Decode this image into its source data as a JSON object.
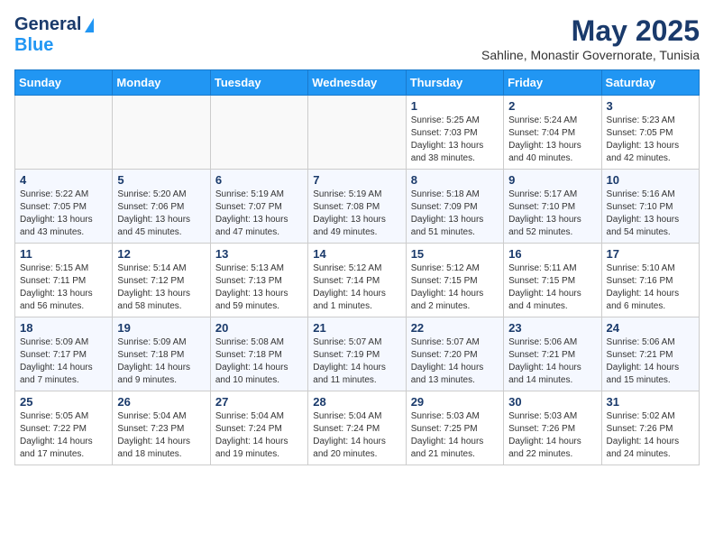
{
  "header": {
    "logo": {
      "general": "General",
      "blue": "Blue"
    },
    "title": "May 2025",
    "subtitle": "Sahline, Monastir Governorate, Tunisia"
  },
  "weekdays": [
    "Sunday",
    "Monday",
    "Tuesday",
    "Wednesday",
    "Thursday",
    "Friday",
    "Saturday"
  ],
  "weeks": [
    [
      null,
      null,
      null,
      null,
      {
        "day": 1,
        "sunrise": "5:25 AM",
        "sunset": "7:03 PM",
        "daylight_hours": 13,
        "daylight_minutes": 38
      },
      {
        "day": 2,
        "sunrise": "5:24 AM",
        "sunset": "7:04 PM",
        "daylight_hours": 13,
        "daylight_minutes": 40
      },
      {
        "day": 3,
        "sunrise": "5:23 AM",
        "sunset": "7:05 PM",
        "daylight_hours": 13,
        "daylight_minutes": 42
      }
    ],
    [
      {
        "day": 4,
        "sunrise": "5:22 AM",
        "sunset": "7:05 PM",
        "daylight_hours": 13,
        "daylight_minutes": 43
      },
      {
        "day": 5,
        "sunrise": "5:20 AM",
        "sunset": "7:06 PM",
        "daylight_hours": 13,
        "daylight_minutes": 45
      },
      {
        "day": 6,
        "sunrise": "5:19 AM",
        "sunset": "7:07 PM",
        "daylight_hours": 13,
        "daylight_minutes": 47
      },
      {
        "day": 7,
        "sunrise": "5:19 AM",
        "sunset": "7:08 PM",
        "daylight_hours": 13,
        "daylight_minutes": 49
      },
      {
        "day": 8,
        "sunrise": "5:18 AM",
        "sunset": "7:09 PM",
        "daylight_hours": 13,
        "daylight_minutes": 51
      },
      {
        "day": 9,
        "sunrise": "5:17 AM",
        "sunset": "7:10 PM",
        "daylight_hours": 13,
        "daylight_minutes": 52
      },
      {
        "day": 10,
        "sunrise": "5:16 AM",
        "sunset": "7:10 PM",
        "daylight_hours": 13,
        "daylight_minutes": 54
      }
    ],
    [
      {
        "day": 11,
        "sunrise": "5:15 AM",
        "sunset": "7:11 PM",
        "daylight_hours": 13,
        "daylight_minutes": 56
      },
      {
        "day": 12,
        "sunrise": "5:14 AM",
        "sunset": "7:12 PM",
        "daylight_hours": 13,
        "daylight_minutes": 58
      },
      {
        "day": 13,
        "sunrise": "5:13 AM",
        "sunset": "7:13 PM",
        "daylight_hours": 13,
        "daylight_minutes": 59
      },
      {
        "day": 14,
        "sunrise": "5:12 AM",
        "sunset": "7:14 PM",
        "daylight_hours": 14,
        "daylight_minutes": 1
      },
      {
        "day": 15,
        "sunrise": "5:12 AM",
        "sunset": "7:15 PM",
        "daylight_hours": 14,
        "daylight_minutes": 2
      },
      {
        "day": 16,
        "sunrise": "5:11 AM",
        "sunset": "7:15 PM",
        "daylight_hours": 14,
        "daylight_minutes": 4
      },
      {
        "day": 17,
        "sunrise": "5:10 AM",
        "sunset": "7:16 PM",
        "daylight_hours": 14,
        "daylight_minutes": 6
      }
    ],
    [
      {
        "day": 18,
        "sunrise": "5:09 AM",
        "sunset": "7:17 PM",
        "daylight_hours": 14,
        "daylight_minutes": 7
      },
      {
        "day": 19,
        "sunrise": "5:09 AM",
        "sunset": "7:18 PM",
        "daylight_hours": 14,
        "daylight_minutes": 9
      },
      {
        "day": 20,
        "sunrise": "5:08 AM",
        "sunset": "7:18 PM",
        "daylight_hours": 14,
        "daylight_minutes": 10
      },
      {
        "day": 21,
        "sunrise": "5:07 AM",
        "sunset": "7:19 PM",
        "daylight_hours": 14,
        "daylight_minutes": 11
      },
      {
        "day": 22,
        "sunrise": "5:07 AM",
        "sunset": "7:20 PM",
        "daylight_hours": 14,
        "daylight_minutes": 13
      },
      {
        "day": 23,
        "sunrise": "5:06 AM",
        "sunset": "7:21 PM",
        "daylight_hours": 14,
        "daylight_minutes": 14
      },
      {
        "day": 24,
        "sunrise": "5:06 AM",
        "sunset": "7:21 PM",
        "daylight_hours": 14,
        "daylight_minutes": 15
      }
    ],
    [
      {
        "day": 25,
        "sunrise": "5:05 AM",
        "sunset": "7:22 PM",
        "daylight_hours": 14,
        "daylight_minutes": 17
      },
      {
        "day": 26,
        "sunrise": "5:04 AM",
        "sunset": "7:23 PM",
        "daylight_hours": 14,
        "daylight_minutes": 18
      },
      {
        "day": 27,
        "sunrise": "5:04 AM",
        "sunset": "7:24 PM",
        "daylight_hours": 14,
        "daylight_minutes": 19
      },
      {
        "day": 28,
        "sunrise": "5:04 AM",
        "sunset": "7:24 PM",
        "daylight_hours": 14,
        "daylight_minutes": 20
      },
      {
        "day": 29,
        "sunrise": "5:03 AM",
        "sunset": "7:25 PM",
        "daylight_hours": 14,
        "daylight_minutes": 21
      },
      {
        "day": 30,
        "sunrise": "5:03 AM",
        "sunset": "7:26 PM",
        "daylight_hours": 14,
        "daylight_minutes": 22
      },
      {
        "day": 31,
        "sunrise": "5:02 AM",
        "sunset": "7:26 PM",
        "daylight_hours": 14,
        "daylight_minutes": 24
      }
    ]
  ]
}
